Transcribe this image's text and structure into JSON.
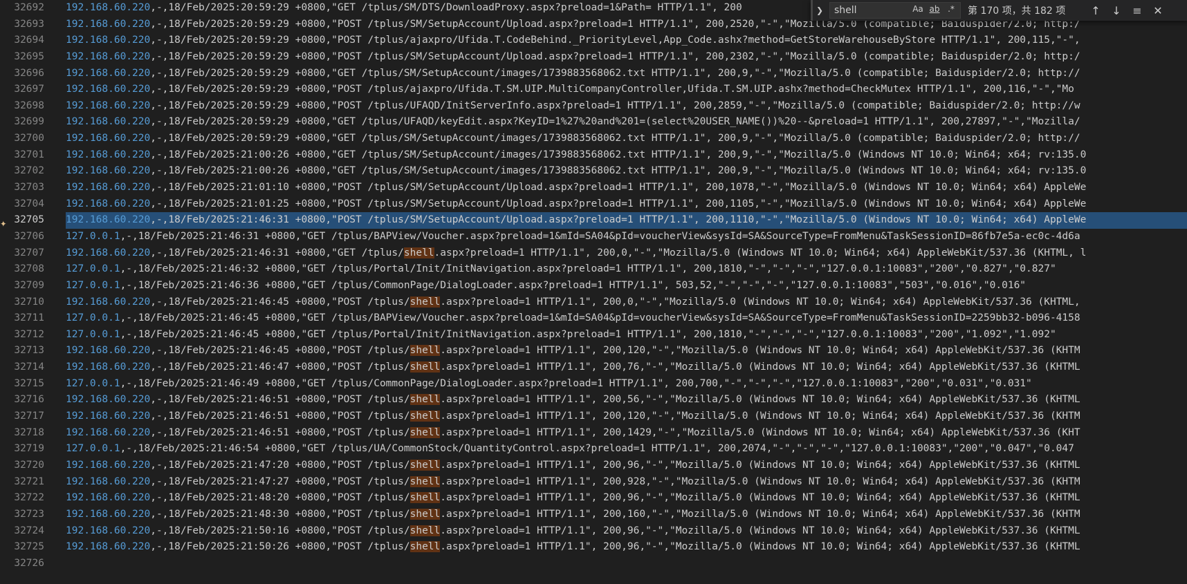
{
  "find_widget": {
    "query": "shell",
    "match_case_label": "Aa",
    "whole_word_label": "ab",
    "regex_label": ".*",
    "result_count": "第 170 项，共 182 项",
    "icons": [
      "chevron-right-icon",
      "arrow-up-icon",
      "arrow-down-icon",
      "selection-icon",
      "close-icon"
    ]
  },
  "editor": {
    "current_line": "32705",
    "glyph_icon": "lightbulb-icon",
    "search_highlight_color": "#613214",
    "selection_color": "#264f78",
    "lines": [
      {
        "num": "32692",
        "ip": "192.168.60.220",
        "rest": ",-,18/Feb/2025:20:59:29 +0800,\"GET /tplus/SM/DTS/DownloadProxy.aspx?preload=1&Path= HTTP/1.1\", 200"
      },
      {
        "num": "32693",
        "ip": "192.168.60.220",
        "rest": ",-,18/Feb/2025:20:59:29 +0800,\"POST /tplus/SM/SetupAccount/Upload.aspx?preload=1 HTTP/1.1\", 200,2520,\"-\",\"Mozilla/5.0 (compatible; Baiduspider/2.0; http:/"
      },
      {
        "num": "32694",
        "ip": "192.168.60.220",
        "rest": ",-,18/Feb/2025:20:59:29 +0800,\"POST /tplus/ajaxpro/Ufida.T.CodeBehind._PriorityLevel,App_Code.ashx?method=GetStoreWarehouseByStore HTTP/1.1\", 200,115,\"-\","
      },
      {
        "num": "32695",
        "ip": "192.168.60.220",
        "rest": ",-,18/Feb/2025:20:59:29 +0800,\"POST /tplus/SM/SetupAccount/Upload.aspx?preload=1 HTTP/1.1\", 200,2302,\"-\",\"Mozilla/5.0 (compatible; Baiduspider/2.0; http:/"
      },
      {
        "num": "32696",
        "ip": "192.168.60.220",
        "rest": ",-,18/Feb/2025:20:59:29 +0800,\"GET /tplus/SM/SetupAccount/images/1739883568062.txt HTTP/1.1\", 200,9,\"-\",\"Mozilla/5.0 (compatible; Baiduspider/2.0; http://"
      },
      {
        "num": "32697",
        "ip": "192.168.60.220",
        "rest": ",-,18/Feb/2025:20:59:29 +0800,\"POST /tplus/ajaxpro/Ufida.T.SM.UIP.MultiCompanyController,Ufida.T.SM.UIP.ashx?method=CheckMutex HTTP/1.1\", 200,116,\"-\",\"Mo"
      },
      {
        "num": "32698",
        "ip": "192.168.60.220",
        "rest": ",-,18/Feb/2025:20:59:29 +0800,\"POST /tplus/UFAQD/InitServerInfo.aspx?preload=1 HTTP/1.1\", 200,2859,\"-\",\"Mozilla/5.0 (compatible; Baiduspider/2.0; http://w"
      },
      {
        "num": "32699",
        "ip": "192.168.60.220",
        "rest": ",-,18/Feb/2025:20:59:29 +0800,\"GET /tplus/UFAQD/keyEdit.aspx?KeyID=1%27%20and%201=(select%20USER_NAME())%20--&preload=1 HTTP/1.1\", 200,27897,\"-\",\"Mozilla/"
      },
      {
        "num": "32700",
        "ip": "192.168.60.220",
        "rest": ",-,18/Feb/2025:20:59:29 +0800,\"GET /tplus/SM/SetupAccount/images/1739883568062.txt HTTP/1.1\", 200,9,\"-\",\"Mozilla/5.0 (compatible; Baiduspider/2.0; http://"
      },
      {
        "num": "32701",
        "ip": "192.168.60.220",
        "rest": ",-,18/Feb/2025:21:00:26 +0800,\"GET /tplus/SM/SetupAccount/images/1739883568062.txt HTTP/1.1\", 200,9,\"-\",\"Mozilla/5.0 (Windows NT 10.0; Win64; x64; rv:135.0"
      },
      {
        "num": "32702",
        "ip": "192.168.60.220",
        "rest": ",-,18/Feb/2025:21:00:26 +0800,\"GET /tplus/SM/SetupAccount/images/1739883568062.txt HTTP/1.1\", 200,9,\"-\",\"Mozilla/5.0 (Windows NT 10.0; Win64; x64; rv:135.0"
      },
      {
        "num": "32703",
        "ip": "192.168.60.220",
        "rest": ",-,18/Feb/2025:21:01:10 +0800,\"POST /tplus/SM/SetupAccount/Upload.aspx?preload=1 HTTP/1.1\", 200,1078,\"-\",\"Mozilla/5.0 (Windows NT 10.0; Win64; x64) AppleWe"
      },
      {
        "num": "32704",
        "ip": "192.168.60.220",
        "rest": ",-,18/Feb/2025:21:01:25 +0800,\"POST /tplus/SM/SetupAccount/Upload.aspx?preload=1 HTTP/1.1\", 200,1105,\"-\",\"Mozilla/5.0 (Windows NT 10.0; Win64; x64) AppleWe"
      },
      {
        "num": "32705",
        "ip": "192.168.60.220",
        "rest": ",-,18/Feb/2025:21:46:31 +0800,\"POST /tplus/SM/SetupAccount/Upload.aspx?preload=1 HTTP/1.1\", 200,1110,\"-\",\"Mozilla/5.0 (Windows NT 10.0; Win64; x64) AppleWe",
        "selected": true
      },
      {
        "num": "32706",
        "ip": "127.0.0.1",
        "rest": ",-,18/Feb/2025:21:46:31 +0800,\"GET /tplus/BAPView/Voucher.aspx?preload=1&mId=SA04&pId=voucherView&sysId=SA&SourceType=FromMenu&TaskSessionID=86fb7e5a-ec0c-4d6a"
      },
      {
        "num": "32707",
        "ip": "192.168.60.220",
        "pre": ",-,18/Feb/2025:21:46:31 +0800,\"GET /tplus/",
        "match": "shell",
        "rest": ".aspx?preload=1 HTTP/1.1\", 200,0,\"-\",\"Mozilla/5.0 (Windows NT 10.0; Win64; x64) AppleWebKit/537.36 (KHTML, l"
      },
      {
        "num": "32708",
        "ip": "127.0.0.1",
        "rest": ",-,18/Feb/2025:21:46:32 +0800,\"GET /tplus/Portal/Init/InitNavigation.aspx?preload=1 HTTP/1.1\", 200,1810,\"-\",\"-\",\"-\",\"127.0.0.1:10083\",\"200\",\"0.827\",\"0.827\""
      },
      {
        "num": "32709",
        "ip": "127.0.0.1",
        "rest": ",-,18/Feb/2025:21:46:36 +0800,\"GET /tplus/CommonPage/DialogLoader.aspx?preload=1 HTTP/1.1\", 503,52,\"-\",\"-\",\"-\",\"127.0.0.1:10083\",\"503\",\"0.016\",\"0.016\""
      },
      {
        "num": "32710",
        "ip": "192.168.60.220",
        "pre": ",-,18/Feb/2025:21:46:45 +0800,\"POST /tplus/",
        "match": "shell",
        "rest": ".aspx?preload=1 HTTP/1.1\", 200,0,\"-\",\"Mozilla/5.0 (Windows NT 10.0; Win64; x64) AppleWebKit/537.36 (KHTML,"
      },
      {
        "num": "32711",
        "ip": "127.0.0.1",
        "rest": ",-,18/Feb/2025:21:46:45 +0800,\"GET /tplus/BAPView/Voucher.aspx?preload=1&mId=SA04&pId=voucherView&sysId=SA&SourceType=FromMenu&TaskSessionID=2259bb32-b096-4158"
      },
      {
        "num": "32712",
        "ip": "127.0.0.1",
        "rest": ",-,18/Feb/2025:21:46:45 +0800,\"GET /tplus/Portal/Init/InitNavigation.aspx?preload=1 HTTP/1.1\", 200,1810,\"-\",\"-\",\"-\",\"127.0.0.1:10083\",\"200\",\"1.092\",\"1.092\""
      },
      {
        "num": "32713",
        "ip": "192.168.60.220",
        "pre": ",-,18/Feb/2025:21:46:45 +0800,\"POST /tplus/",
        "match": "shell",
        "rest": ".aspx?preload=1 HTTP/1.1\", 200,120,\"-\",\"Mozilla/5.0 (Windows NT 10.0; Win64; x64) AppleWebKit/537.36 (KHTM"
      },
      {
        "num": "32714",
        "ip": "192.168.60.220",
        "pre": ",-,18/Feb/2025:21:46:47 +0800,\"POST /tplus/",
        "match": "shell",
        "rest": ".aspx?preload=1 HTTP/1.1\", 200,76,\"-\",\"Mozilla/5.0 (Windows NT 10.0; Win64; x64) AppleWebKit/537.36 (KHTML"
      },
      {
        "num": "32715",
        "ip": "127.0.0.1",
        "rest": ",-,18/Feb/2025:21:46:49 +0800,\"GET /tplus/CommonPage/DialogLoader.aspx?preload=1 HTTP/1.1\", 200,700,\"-\",\"-\",\"-\",\"127.0.0.1:10083\",\"200\",\"0.031\",\"0.031\""
      },
      {
        "num": "32716",
        "ip": "192.168.60.220",
        "pre": ",-,18/Feb/2025:21:46:51 +0800,\"POST /tplus/",
        "match": "shell",
        "rest": ".aspx?preload=1 HTTP/1.1\", 200,56,\"-\",\"Mozilla/5.0 (Windows NT 10.0; Win64; x64) AppleWebKit/537.36 (KHTML"
      },
      {
        "num": "32717",
        "ip": "192.168.60.220",
        "pre": ",-,18/Feb/2025:21:46:51 +0800,\"POST /tplus/",
        "match": "shell",
        "rest": ".aspx?preload=1 HTTP/1.1\", 200,120,\"-\",\"Mozilla/5.0 (Windows NT 10.0; Win64; x64) AppleWebKit/537.36 (KHTM"
      },
      {
        "num": "32718",
        "ip": "192.168.60.220",
        "pre": ",-,18/Feb/2025:21:46:51 +0800,\"POST /tplus/",
        "match": "shell",
        "rest": ".aspx?preload=1 HTTP/1.1\", 200,1429,\"-\",\"Mozilla/5.0 (Windows NT 10.0; Win64; x64) AppleWebKit/537.36 (KHT"
      },
      {
        "num": "32719",
        "ip": "127.0.0.1",
        "rest": ",-,18/Feb/2025:21:46:54 +0800,\"GET /tplus/UA/CommonStock/QuantityControl.aspx?preload=1 HTTP/1.1\", 200,2074,\"-\",\"-\",\"-\",\"127.0.0.1:10083\",\"200\",\"0.047\",\"0.047"
      },
      {
        "num": "32720",
        "ip": "192.168.60.220",
        "pre": ",-,18/Feb/2025:21:47:20 +0800,\"POST /tplus/",
        "match": "shell",
        "rest": ".aspx?preload=1 HTTP/1.1\", 200,96,\"-\",\"Mozilla/5.0 (Windows NT 10.0; Win64; x64) AppleWebKit/537.36 (KHTML"
      },
      {
        "num": "32721",
        "ip": "192.168.60.220",
        "pre": ",-,18/Feb/2025:21:47:27 +0800,\"POST /tplus/",
        "match": "shell",
        "rest": ".aspx?preload=1 HTTP/1.1\", 200,928,\"-\",\"Mozilla/5.0 (Windows NT 10.0; Win64; x64) AppleWebKit/537.36 (KHTM"
      },
      {
        "num": "32722",
        "ip": "192.168.60.220",
        "pre": ",-,18/Feb/2025:21:48:20 +0800,\"POST /tplus/",
        "match": "shell",
        "rest": ".aspx?preload=1 HTTP/1.1\", 200,96,\"-\",\"Mozilla/5.0 (Windows NT 10.0; Win64; x64) AppleWebKit/537.36 (KHTML"
      },
      {
        "num": "32723",
        "ip": "192.168.60.220",
        "pre": ",-,18/Feb/2025:21:48:30 +0800,\"POST /tplus/",
        "match": "shell",
        "rest": ".aspx?preload=1 HTTP/1.1\", 200,160,\"-\",\"Mozilla/5.0 (Windows NT 10.0; Win64; x64) AppleWebKit/537.36 (KHTM"
      },
      {
        "num": "32724",
        "ip": "192.168.60.220",
        "pre": ",-,18/Feb/2025:21:50:16 +0800,\"POST /tplus/",
        "match": "shell",
        "rest": ".aspx?preload=1 HTTP/1.1\", 200,96,\"-\",\"Mozilla/5.0 (Windows NT 10.0; Win64; x64) AppleWebKit/537.36 (KHTML"
      },
      {
        "num": "32725",
        "ip": "192.168.60.220",
        "pre": ",-,18/Feb/2025:21:50:26 +0800,\"POST /tplus/",
        "match": "shell",
        "rest": ".aspx?preload=1 HTTP/1.1\", 200,96,\"-\",\"Mozilla/5.0 (Windows NT 10.0; Win64; x64) AppleWebKit/537.36 (KHTML"
      },
      {
        "num": "32726",
        "ip": "",
        "rest": ""
      }
    ]
  }
}
